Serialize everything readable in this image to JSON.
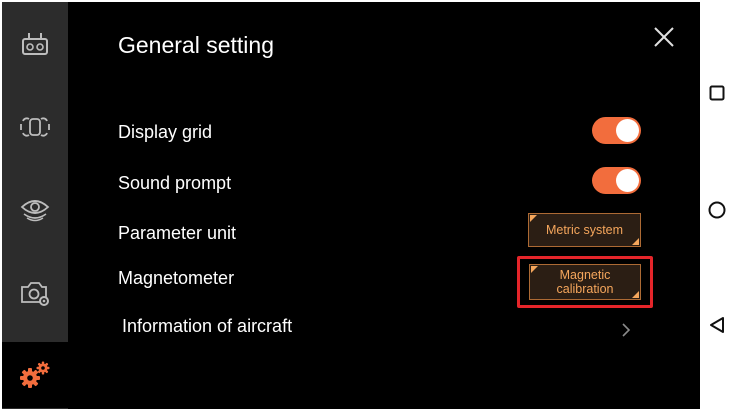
{
  "settings": {
    "title": "General setting",
    "rows": {
      "display_grid": {
        "label": "Display grid",
        "enabled": true
      },
      "sound_prompt": {
        "label": "Sound prompt",
        "enabled": true
      },
      "parameter_unit": {
        "label": "Parameter unit",
        "value": "Metric system"
      },
      "magnetometer": {
        "label": "Magnetometer",
        "button_line1": "Magnetic",
        "button_line2": "calibration"
      },
      "aircraft_info": {
        "label": "Information of aircraft"
      }
    }
  },
  "sidebar": {
    "items": [
      {
        "icon": "remote-controller-icon"
      },
      {
        "icon": "aircraft-icon"
      },
      {
        "icon": "vision-sensor-icon"
      },
      {
        "icon": "camera-settings-icon"
      },
      {
        "icon": "gears-icon",
        "active": true
      }
    ]
  },
  "android_nav": {
    "buttons": [
      "recent-apps-icon",
      "home-icon",
      "back-icon"
    ]
  },
  "colors": {
    "accent": "#f26d3d",
    "button_text": "#f5a65c",
    "highlight": "#e5252a",
    "background": "#000000",
    "sidebar": "#2c2c2c"
  }
}
